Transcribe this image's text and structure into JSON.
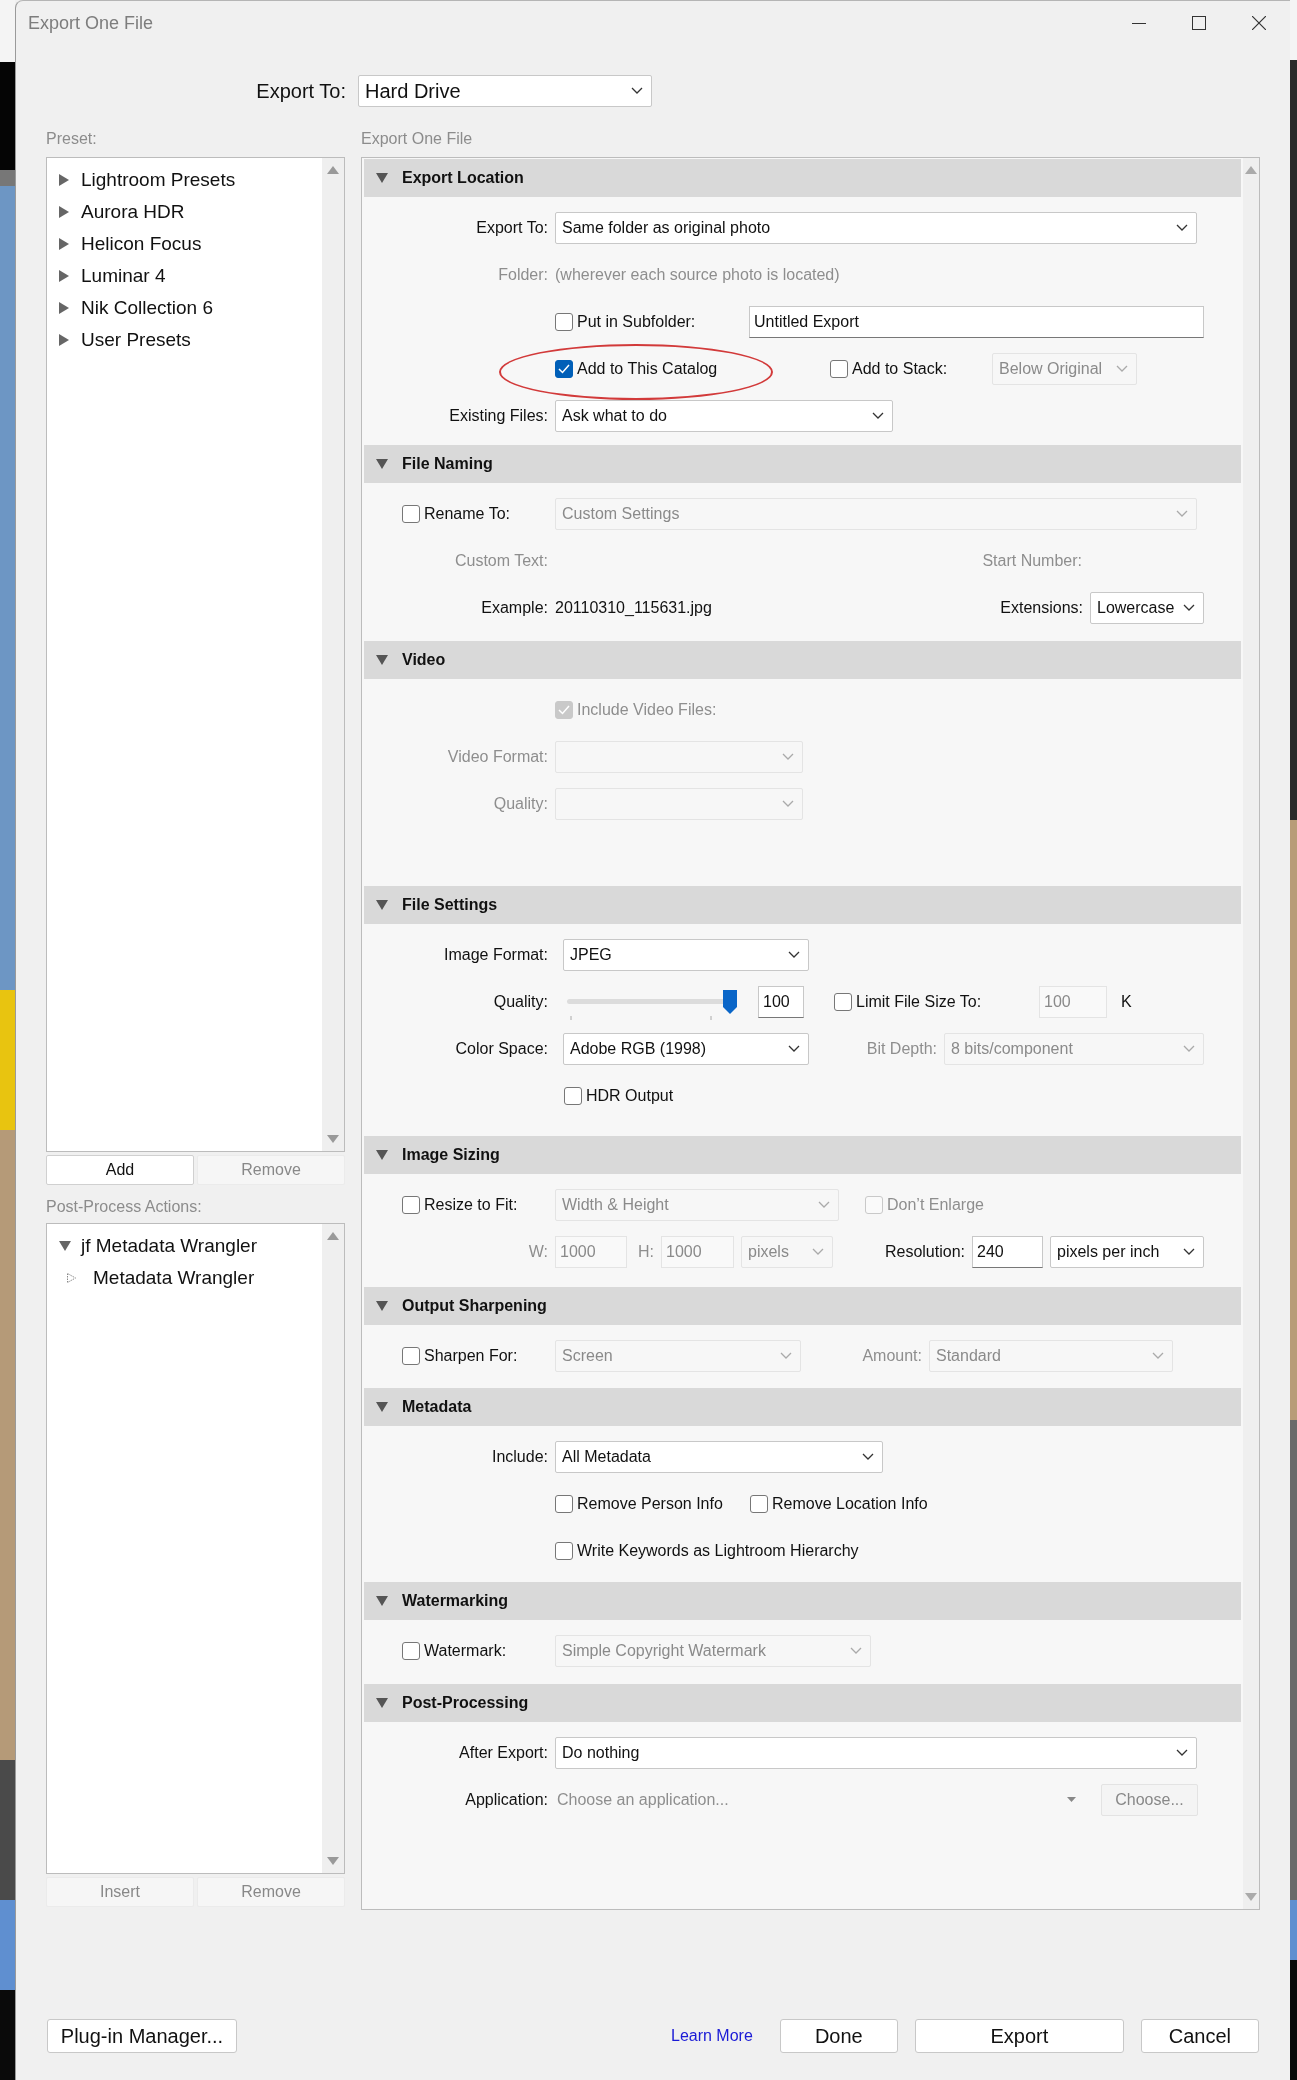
{
  "window": {
    "title": "Export One File"
  },
  "export_to": {
    "label": "Export To:",
    "value": "Hard Drive"
  },
  "preset": {
    "label": "Preset:",
    "items": [
      {
        "label": "Lightroom Presets",
        "expanded": false
      },
      {
        "label": "Aurora HDR",
        "expanded": false
      },
      {
        "label": "Helicon Focus",
        "expanded": false
      },
      {
        "label": "Luminar 4",
        "expanded": false
      },
      {
        "label": "Nik Collection 6",
        "expanded": false
      },
      {
        "label": "User Presets",
        "expanded": false
      }
    ],
    "buttons": [
      {
        "label": "Add",
        "disabled": false
      },
      {
        "label": "Remove",
        "disabled": true
      }
    ]
  },
  "post_process_actions": {
    "label": "Post-Process Actions:",
    "items": [
      {
        "label": "jf Metadata Wrangler",
        "expanded": true,
        "children": [
          {
            "label": "Metadata Wrangler"
          }
        ]
      }
    ],
    "buttons": [
      {
        "label": "Insert",
        "disabled": true
      },
      {
        "label": "Remove",
        "disabled": true
      }
    ]
  },
  "panel": {
    "title": "Export One File",
    "sections": [
      {
        "title": "Export Location",
        "expanded": true,
        "rows": [
          {
            "kind": "field",
            "items": [
              {
                "kind": "label",
                "text": "Export To:",
                "disabled": false
              },
              {
                "kind": "select",
                "value": "Same folder as original photo",
                "disabled": false
              }
            ]
          },
          {
            "kind": "field",
            "items": [
              {
                "kind": "label",
                "text": "Folder:",
                "disabled": true
              },
              {
                "kind": "text",
                "text": "(wherever each source photo is located)",
                "disabled": true
              }
            ]
          },
          {
            "kind": "plain",
            "items": [
              {
                "kind": "checkbox",
                "label": "Put in Subfolder:",
                "checked": false,
                "disabled": false
              },
              {
                "kind": "input",
                "value": "Untitled Export",
                "disabled": false
              }
            ]
          },
          {
            "kind": "plain",
            "items": [
              {
                "kind": "checkbox",
                "label": "Add to This Catalog",
                "checked": true,
                "disabled": false,
                "circled": true
              },
              {
                "kind": "checkbox",
                "label": "Add to Stack:",
                "checked": false,
                "disabled": false
              },
              {
                "kind": "select",
                "value": "Below Original",
                "disabled": true
              }
            ]
          },
          {
            "kind": "field",
            "items": [
              {
                "kind": "label",
                "text": "Existing Files:",
                "disabled": false
              },
              {
                "kind": "select",
                "value": "Ask what to do",
                "disabled": false
              }
            ]
          }
        ]
      },
      {
        "title": "File Naming",
        "expanded": true,
        "rows": [
          {
            "kind": "option",
            "items": [
              {
                "kind": "checkbox",
                "label": "Rename To:",
                "checked": false,
                "disabled": false
              },
              {
                "kind": "select",
                "value": "Custom Settings",
                "disabled": true
              }
            ]
          },
          {
            "kind": "field",
            "items": [
              {
                "kind": "label",
                "text": "Custom Text:",
                "disabled": true
              },
              {
                "kind": "label",
                "text": "Start Number:",
                "disabled": true
              }
            ]
          },
          {
            "kind": "field",
            "items": [
              {
                "kind": "label",
                "text": "Example:",
                "disabled": false
              },
              {
                "kind": "text",
                "text": "20110310_115631.jpg",
                "disabled": false
              },
              {
                "kind": "label",
                "text": "Extensions:",
                "disabled": false
              },
              {
                "kind": "select",
                "value": "Lowercase",
                "disabled": false
              }
            ]
          }
        ]
      },
      {
        "title": "Video",
        "expanded": true,
        "rows": [
          {
            "kind": "plain",
            "items": [
              {
                "kind": "checkbox",
                "label": "Include Video Files:",
                "checked": true,
                "disabled": true
              }
            ]
          },
          {
            "kind": "field",
            "items": [
              {
                "kind": "label",
                "text": "Video Format:",
                "disabled": true
              },
              {
                "kind": "select",
                "disabled": true
              }
            ]
          },
          {
            "kind": "field",
            "items": [
              {
                "kind": "label",
                "text": "Quality:",
                "disabled": true
              },
              {
                "kind": "select",
                "disabled": true
              }
            ]
          }
        ]
      },
      {
        "title": "File Settings",
        "expanded": true,
        "rows": [
          {
            "kind": "field",
            "items": [
              {
                "kind": "label",
                "text": "Image Format:",
                "disabled": false
              },
              {
                "kind": "select",
                "value": "JPEG",
                "disabled": false
              }
            ]
          },
          {
            "kind": "field",
            "items": [
              {
                "kind": "label",
                "text": "Quality:",
                "disabled": false
              },
              {
                "kind": "slider",
                "level": 1,
                "disabled": false
              },
              {
                "kind": "input",
                "value": "100",
                "disabled": false
              },
              {
                "kind": "checkbox",
                "label": "Limit File Size To:",
                "checked": false,
                "disabled": false
              },
              {
                "kind": "input",
                "value": "100",
                "disabled": true
              },
              {
                "kind": "text",
                "text": "K",
                "disabled": false
              }
            ]
          },
          {
            "kind": "field",
            "items": [
              {
                "kind": "label",
                "text": "Color Space:",
                "disabled": false
              },
              {
                "kind": "select",
                "value": "Adobe RGB (1998)",
                "disabled": false
              },
              {
                "kind": "label",
                "text": "Bit Depth:",
                "disabled": true
              },
              {
                "kind": "select",
                "value": "8 bits/component",
                "disabled": true
              }
            ]
          },
          {
            "kind": "plain",
            "items": [
              {
                "kind": "checkbox",
                "label": "HDR Output",
                "checked": false,
                "disabled": false
              }
            ]
          }
        ]
      },
      {
        "title": "Image Sizing",
        "expanded": true,
        "rows": [
          {
            "kind": "option",
            "items": [
              {
                "kind": "checkbox",
                "label": "Resize to Fit:",
                "checked": false,
                "disabled": false
              },
              {
                "kind": "select",
                "value": "Width & Height",
                "disabled": true
              },
              {
                "kind": "checkbox",
                "label": "Don’t Enlarge",
                "checked": false,
                "disabled": true
              }
            ]
          },
          {
            "kind": "field",
            "items": [
              {
                "kind": "label",
                "text": "W:",
                "disabled": true
              },
              {
                "kind": "input",
                "value": "1000",
                "disabled": true
              },
              {
                "kind": "label",
                "text": "H:",
                "disabled": true
              },
              {
                "kind": "input",
                "value": "1000",
                "disabled": true
              },
              {
                "kind": "select",
                "value": "pixels",
                "disabled": true
              },
              {
                "kind": "label",
                "text": "Resolution:",
                "disabled": false
              },
              {
                "kind": "input",
                "value": "240",
                "disabled": false
              },
              {
                "kind": "select",
                "value": "pixels per inch",
                "disabled": false
              }
            ]
          }
        ]
      },
      {
        "title": "Output Sharpening",
        "expanded": true,
        "rows": [
          {
            "kind": "option",
            "items": [
              {
                "kind": "checkbox",
                "label": "Sharpen For:",
                "checked": false,
                "disabled": false
              },
              {
                "kind": "select",
                "value": "Screen",
                "disabled": true
              },
              {
                "kind": "label",
                "text": "Amount:",
                "disabled": true
              },
              {
                "kind": "select",
                "value": "Standard",
                "disabled": true
              }
            ]
          }
        ]
      },
      {
        "title": "Metadata",
        "expanded": true,
        "rows": [
          {
            "kind": "field",
            "items": [
              {
                "kind": "label",
                "text": "Include:",
                "disabled": false
              },
              {
                "kind": "select",
                "value": "All Metadata",
                "disabled": false
              }
            ]
          },
          {
            "kind": "plain",
            "items": [
              {
                "kind": "checkbox",
                "label": "Remove Person Info",
                "checked": false,
                "disabled": false
              },
              {
                "kind": "checkbox",
                "label": "Remove Location Info",
                "checked": false,
                "disabled": false
              }
            ]
          },
          {
            "kind": "plain",
            "items": [
              {
                "kind": "checkbox",
                "label": "Write Keywords as Lightroom Hierarchy",
                "checked": false,
                "disabled": false
              }
            ]
          }
        ]
      },
      {
        "title": "Watermarking",
        "expanded": true,
        "rows": [
          {
            "kind": "option",
            "items": [
              {
                "kind": "checkbox",
                "label": "Watermark:",
                "checked": false,
                "disabled": false
              },
              {
                "kind": "select",
                "value": "Simple Copyright Watermark",
                "disabled": true
              }
            ]
          }
        ]
      },
      {
        "title": "Post-Processing",
        "expanded": true,
        "rows": [
          {
            "kind": "field",
            "items": [
              {
                "kind": "label",
                "text": "After Export:",
                "disabled": false
              },
              {
                "kind": "select",
                "value": "Do nothing",
                "disabled": false
              }
            ]
          },
          {
            "kind": "field",
            "items": [
              {
                "kind": "label",
                "text": "Application:",
                "disabled": false
              },
              {
                "kind": "combo",
                "placeholder": "Choose an application...",
                "disabled": true
              },
              {
                "kind": "button",
                "label": "Choose...",
                "disabled": true
              }
            ]
          }
        ]
      }
    ]
  },
  "footer": {
    "buttons": [
      {
        "kind": "button",
        "label": "Plug-in Manager..."
      },
      {
        "kind": "link",
        "label": "Learn More"
      },
      {
        "kind": "button",
        "label": "Done"
      },
      {
        "kind": "button",
        "label": "Export"
      },
      {
        "kind": "button",
        "label": "Cancel"
      }
    ]
  }
}
